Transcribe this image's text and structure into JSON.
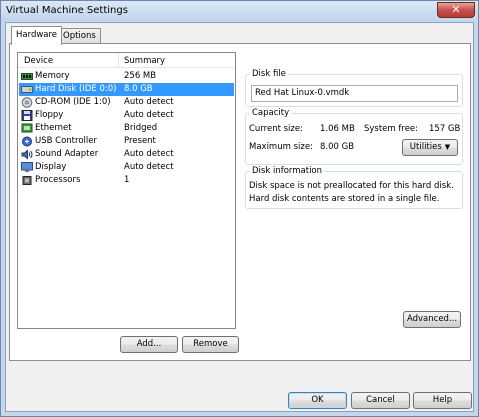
{
  "window": {
    "title": "Virtual Machine Settings",
    "close_glyph": "✕"
  },
  "tabs": [
    {
      "label": "Hardware"
    },
    {
      "label": "Options"
    }
  ],
  "device_list": {
    "col_device": "Device",
    "col_summary": "Summary",
    "rows": [
      {
        "device": "Memory",
        "summary": "256 MB",
        "icon": "memory-icon"
      },
      {
        "device": "Hard Disk (IDE 0:0)",
        "summary": "8.0 GB",
        "icon": "hard-disk-icon"
      },
      {
        "device": "CD-ROM (IDE 1:0)",
        "summary": "Auto detect",
        "icon": "cd-rom-icon"
      },
      {
        "device": "Floppy",
        "summary": "Auto detect",
        "icon": "floppy-icon"
      },
      {
        "device": "Ethernet",
        "summary": "Bridged",
        "icon": "ethernet-icon"
      },
      {
        "device": "USB Controller",
        "summary": "Present",
        "icon": "usb-icon"
      },
      {
        "device": "Sound Adapter",
        "summary": "Auto detect",
        "icon": "sound-icon"
      },
      {
        "device": "Display",
        "summary": "Auto detect",
        "icon": "display-icon"
      },
      {
        "device": "Processors",
        "summary": "1",
        "icon": "processor-icon"
      }
    ],
    "selected_index": 1
  },
  "buttons": {
    "add": "Add...",
    "remove": "Remove",
    "utilities": "Utilities",
    "advanced": "Advanced...",
    "ok": "OK",
    "cancel": "Cancel",
    "help": "Help"
  },
  "disk_file": {
    "title": "Disk file",
    "value": "Red Hat Linux-0.vmdk"
  },
  "capacity": {
    "title": "Capacity",
    "current_size_label": "Current size:",
    "current_size": "1.06 MB",
    "system_free_label": "System free:",
    "system_free": "157 GB",
    "maximum_size_label": "Maximum size:",
    "maximum_size": "8.00 GB"
  },
  "disk_information": {
    "title": "Disk information",
    "line1": "Disk space is not preallocated for this hard disk.",
    "line2": "Hard disk contents are stored in a single file."
  },
  "colors": {
    "selection": "#3399ff",
    "dialog_bg": "#f0f0f0"
  }
}
